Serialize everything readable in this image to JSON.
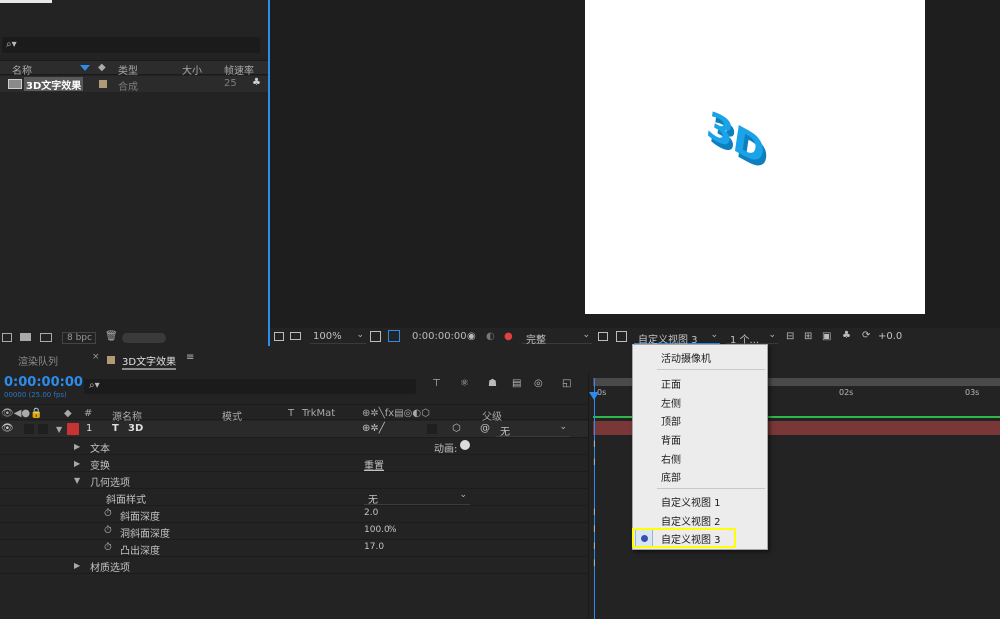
{
  "project_panel": {
    "search_placeholder": "",
    "columns": {
      "name": "名称",
      "type": "类型",
      "size": "大小",
      "fps": "帧速率"
    },
    "items": [
      {
        "name": "3D文字效果",
        "type": "合成",
        "fps": "25"
      }
    ],
    "bpc": "8 bpc"
  },
  "viewer": {
    "canvas_text": "3D",
    "toolbar": {
      "zoom": "100%",
      "timecode": "0:00:00:00",
      "resolution": "完整",
      "view": "自定义视图 3",
      "views_count": "1 个...",
      "exposure": "+0.0"
    }
  },
  "view_menu": {
    "items": [
      "活动摄像机",
      "正面",
      "左侧",
      "顶部",
      "背面",
      "右侧",
      "底部",
      "自定义视图 1",
      "自定义视图 2",
      "自定义视图 3"
    ],
    "selected": "自定义视图 3"
  },
  "timeline": {
    "render_queue_tab": "渲染队列",
    "comp_tab": "3D文字效果",
    "current_time": "0:00:00:00",
    "frame_info": "00000 (25.00 fps)",
    "columns": {
      "num": "#",
      "source": "源名称",
      "mode": "模式",
      "t": "T",
      "trkmat": "TrkMat",
      "parent": "父级"
    },
    "layer": {
      "index": "1",
      "type_glyph": "T",
      "name": "3D",
      "parent": "无"
    },
    "rows": {
      "text": "文本",
      "animate": "动画:",
      "transform": "变换",
      "reset": "重置",
      "geometry": "几何选项",
      "bevel_style": "斜面样式",
      "bevel_style_value": "无",
      "bevel_depth": "斜面深度",
      "bevel_depth_value": "2.0",
      "hole_bevel_depth": "洞斜面深度",
      "hole_bevel_depth_value": "100.0",
      "hole_bevel_unit": "%",
      "extrusion_depth": "凸出深度",
      "extrusion_depth_value": "17.0",
      "material": "材质选项"
    },
    "ruler": {
      "t0": "0s",
      "t2": "02s",
      "t3": "03s"
    }
  },
  "colors": {
    "accent_blue": "#2d8ceb",
    "layer_red": "#c73232",
    "bar_red": "#7a3737",
    "text_3d": "#1aa3e8",
    "highlight_yellow": "#ffff00"
  }
}
